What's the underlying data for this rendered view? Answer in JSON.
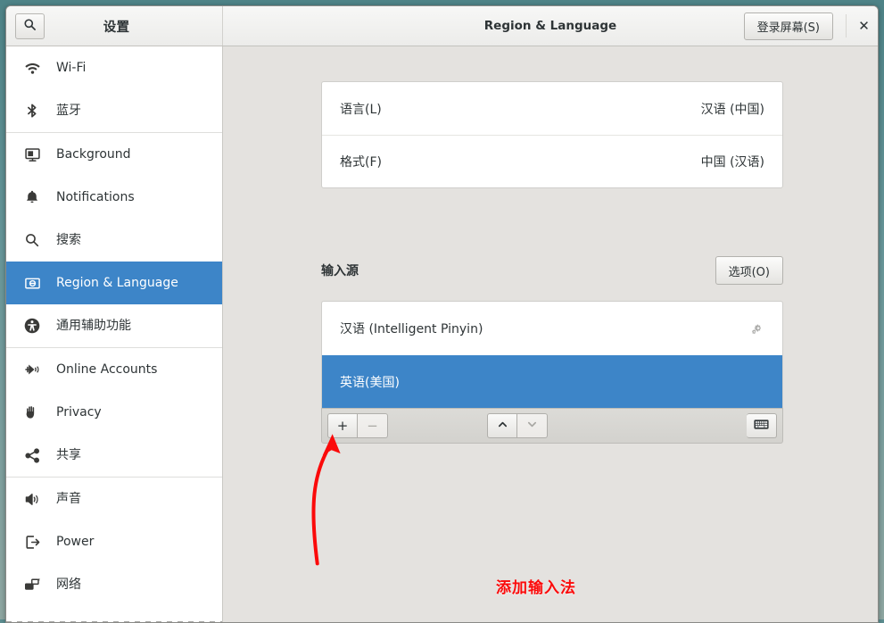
{
  "window": {
    "app_title": "设置",
    "panel_title": "Region & Language",
    "login_screen_label": "登录屏幕(S)",
    "close_label": "✕",
    "search_icon": "search-icon"
  },
  "sidebar": {
    "items": [
      {
        "label": "Wi-Fi",
        "icon": "wifi-icon",
        "selected": false
      },
      {
        "label": "蓝牙",
        "icon": "bluetooth-icon",
        "selected": false
      },
      {
        "label": "Background",
        "icon": "monitor-icon",
        "selected": false
      },
      {
        "label": "Notifications",
        "icon": "bell-icon",
        "selected": false
      },
      {
        "label": "搜索",
        "icon": "search-icon",
        "selected": false
      },
      {
        "label": "Region & Language",
        "icon": "region-language-icon",
        "selected": true
      },
      {
        "label": "通用辅助功能",
        "icon": "accessibility-icon",
        "selected": false
      },
      {
        "label": "Online Accounts",
        "icon": "online-accounts-icon",
        "selected": false
      },
      {
        "label": "Privacy",
        "icon": "hand-icon",
        "selected": false
      },
      {
        "label": "共享",
        "icon": "share-icon",
        "selected": false
      },
      {
        "label": "声音",
        "icon": "speaker-icon",
        "selected": false
      },
      {
        "label": "Power",
        "icon": "power-icon",
        "selected": false
      },
      {
        "label": "网络",
        "icon": "network-icon",
        "selected": false
      }
    ]
  },
  "main": {
    "language_row": {
      "label": "语言(L)",
      "value": "汉语 (中国)"
    },
    "format_row": {
      "label": "格式(F)",
      "value": "中国 (汉语)"
    },
    "input_sources": {
      "title": "输入源",
      "options_label": "选项(O)",
      "rows": [
        {
          "label": "汉语 (Intelligent Pinyin)",
          "selected": false,
          "has_gear": true
        },
        {
          "label": "英语(美国)",
          "selected": true,
          "has_gear": false
        }
      ],
      "toolbar": {
        "add_label": "+",
        "remove_label": "−",
        "move_up_icon": "chevron-up-icon",
        "move_down_icon": "chevron-down-icon",
        "keyboard_icon": "keyboard-icon"
      }
    }
  },
  "annotation": {
    "text": "添加输入法",
    "color": "#fb0a0a",
    "arrow_target": "add-input-source-button"
  }
}
